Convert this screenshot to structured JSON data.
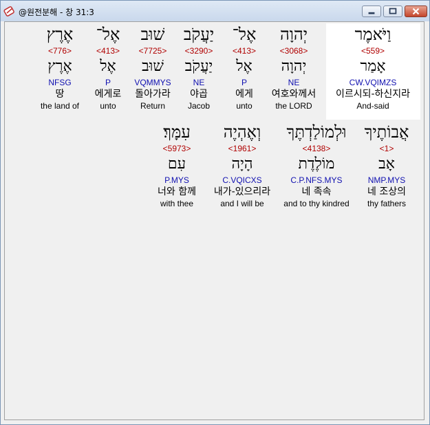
{
  "window": {
    "title": "@원전분해 - 창 31:3",
    "icons": [
      "app-icon",
      "minimize-icon",
      "maximize-icon",
      "close-icon"
    ]
  },
  "rows": [
    [
      {
        "heb": "וַיֹּאמֶר",
        "strong": "<559>",
        "root": "אָמַר",
        "morph": "CW.VQIMZS",
        "kor": "이르시되-하신지라",
        "eng": "And-said",
        "highlight": true
      },
      {
        "heb": "יְהוָה",
        "strong": "<3068>",
        "root": "יְהוָה",
        "morph": "NE",
        "kor": "여호와께서",
        "eng": "the LORD"
      },
      {
        "heb": "אֶל־",
        "strong": "<413>",
        "root": "אֶל",
        "morph": "P",
        "kor": "에게",
        "eng": "unto"
      },
      {
        "heb": "יַעֲקֹב",
        "strong": "<3290>",
        "root": "יַעֲקֹב",
        "morph": "NE",
        "kor": "야곱",
        "eng": "Jacob"
      },
      {
        "heb": "שׁוּב",
        "strong": "<7725>",
        "root": "שׁוּב",
        "morph": "VQMMYS",
        "kor": "돌아가라",
        "eng": "Return"
      },
      {
        "heb": "אֶל־",
        "strong": "<413>",
        "root": "אֶל",
        "morph": "P",
        "kor": "에게로",
        "eng": "unto"
      },
      {
        "heb": "אֶרֶץ",
        "strong": "<776>",
        "root": "אֶרֶץ",
        "morph": "NFSG",
        "kor": "땅",
        "eng": "the land of"
      }
    ],
    [
      {
        "heb": "אֲבוֹתֶיךָ",
        "strong": "<1>",
        "root": "אָב",
        "morph": "NMP.MYS",
        "kor": "네 조상의",
        "eng": "thy fathers"
      },
      {
        "heb": "וּלְמוֹלַדְתֶּךָ",
        "strong": "<4138>",
        "root": "מוֹלֶדֶת",
        "morph": "C.P.NFS.MYS",
        "kor": "네 족속",
        "eng": "and to thy kindred"
      },
      {
        "heb": "וְאֶהְיֶה",
        "strong": "<1961>",
        "root": "הָיָה",
        "morph": "C.VQICXS",
        "kor": "내가-있으리라",
        "eng": "and I will be"
      },
      {
        "heb": "עִמָּךְ׃",
        "strong": "<5973>",
        "root": "עִם",
        "morph": "P.MYS",
        "kor": "너와 함께",
        "eng": "with thee"
      }
    ]
  ]
}
